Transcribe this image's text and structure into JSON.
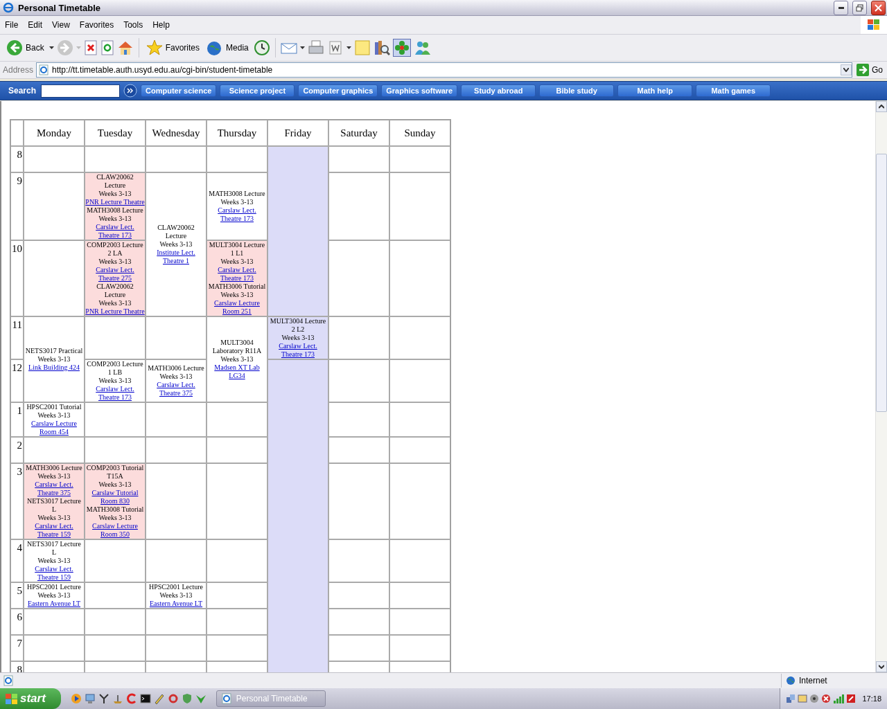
{
  "window": {
    "title": "Personal Timetable"
  },
  "menu": [
    "File",
    "Edit",
    "View",
    "Favorites",
    "Tools",
    "Help"
  ],
  "toolbar": {
    "back": "Back",
    "favorites": "Favorites",
    "media": "Media"
  },
  "address": {
    "label": "Address",
    "value": "http://tt.timetable.auth.usyd.edu.au/cgi-bin/student-timetable",
    "go": "Go"
  },
  "links_bar": {
    "search_label": "Search",
    "links": [
      "Computer science",
      "Science project",
      "Computer graphics",
      "Graphics software",
      "Study abroad",
      "Bible study",
      "Math help",
      "Math games"
    ]
  },
  "timetable": {
    "days": [
      "Monday",
      "Tuesday",
      "Wednesday",
      "Thursday",
      "Friday",
      "Saturday",
      "Sunday"
    ],
    "rows": [
      {
        "hour": "8",
        "cells": [
          {
            "color": "#ffffff"
          },
          {
            "color": "#ffffff"
          },
          {
            "color": "#ffffff"
          },
          {
            "color": "#ffffff"
          },
          {
            "color": "#dcdcf8",
            "rowspan": 3
          },
          {
            "color": "#ffffff"
          },
          {
            "color": "#ffffff"
          }
        ]
      },
      {
        "hour": "9",
        "cells": [
          {
            "color": "#ffffff"
          },
          {
            "color": "#fcdcdc",
            "sessions": [
              {
                "title": "CLAW20062 Lecture",
                "weeks": "Weeks 3-13",
                "room": "PNR Lecture Theatre"
              },
              {
                "title": "MATH3008 Lecture",
                "weeks": "Weeks 3-13",
                "room": "Carslaw Lect. Theatre 173"
              }
            ]
          },
          {
            "color": "#ffffff",
            "rowspan": 2,
            "sessions": [
              {
                "title": "CLAW20062 Lecture",
                "weeks": "Weeks 3-13",
                "room": "Institute Lect. Theatre 1"
              }
            ]
          },
          {
            "color": "#ffffff",
            "sessions": [
              {
                "title": "MATH3008 Lecture",
                "weeks": "Weeks 3-13",
                "room": "Carslaw Lect. Theatre 173"
              }
            ]
          },
          {
            "color": "#ffffff"
          },
          {
            "color": "#ffffff"
          }
        ]
      },
      {
        "hour": "10",
        "cells": [
          {
            "color": "#ffffff"
          },
          {
            "color": "#fcdcdc",
            "sessions": [
              {
                "title": "COMP2003 Lecture 2 LA",
                "weeks": "Weeks 3-13",
                "room": "Carslaw Lect. Theatre 275"
              },
              {
                "title": "CLAW20062 Lecture",
                "weeks": "Weeks 3-13",
                "room": "PNR Lecture Theatre"
              }
            ]
          },
          {
            "color": "#fcdcdc",
            "sessions": [
              {
                "title": "MULT3004 Lecture 1 L1",
                "weeks": "Weeks 3-13",
                "room": "Carslaw Lect. Theatre 173"
              },
              {
                "title": "MATH3006 Tutorial",
                "weeks": "Weeks 3-13",
                "room": "Carslaw Lecture Room 251"
              }
            ]
          },
          {
            "color": "#ffffff"
          },
          {
            "color": "#ffffff"
          }
        ]
      },
      {
        "hour": "11",
        "cells": [
          {
            "color": "#ffffff",
            "rowspan": 2,
            "sessions": [
              {
                "title": "NETS3017 Practical",
                "weeks": "Weeks 3-13",
                "room": "Link Building 424"
              }
            ]
          },
          {
            "color": "#ffffff"
          },
          {
            "color": "#ffffff"
          },
          {
            "color": "#ffffff",
            "rowspan": 2,
            "sessions": [
              {
                "title": "MULT3004 Laboratory R11A",
                "weeks": "Weeks 3-13",
                "room": "Madsen XT Lab LG34"
              }
            ]
          },
          {
            "color": "#dcdcf8",
            "sessions": [
              {
                "title": "MULT3004 Lecture 2 L2",
                "weeks": "Weeks 3-13",
                "room": "Carslaw Lect. Theatre 173"
              }
            ]
          },
          {
            "color": "#ffffff"
          },
          {
            "color": "#ffffff"
          }
        ]
      },
      {
        "hour": "12",
        "cells": [
          {
            "color": "#ffffff",
            "sessions": [
              {
                "title": "COMP2003 Lecture 1 LB",
                "weeks": "Weeks 3-13",
                "room": "Carslaw Lect. Theatre 173"
              }
            ]
          },
          {
            "color": "#ffffff",
            "sessions": [
              {
                "title": "MATH3006 Lecture",
                "weeks": "Weeks 3-13",
                "room": "Carslaw Lect. Theatre 375"
              }
            ]
          },
          {
            "color": "#dcdcf8",
            "rowspan": 9
          },
          {
            "color": "#ffffff"
          },
          {
            "color": "#ffffff"
          }
        ]
      },
      {
        "hour": "1",
        "cells": [
          {
            "color": "#ffffff",
            "sessions": [
              {
                "title": "HPSC2001 Tutorial",
                "weeks": "Weeks 3-13",
                "room": "Carslaw Lecture Room 454"
              }
            ]
          },
          {
            "color": "#ffffff"
          },
          {
            "color": "#ffffff"
          },
          {
            "color": "#ffffff"
          },
          {
            "color": "#ffffff"
          },
          {
            "color": "#ffffff"
          }
        ]
      },
      {
        "hour": "2",
        "cells": [
          {
            "color": "#ffffff"
          },
          {
            "color": "#ffffff"
          },
          {
            "color": "#ffffff"
          },
          {
            "color": "#ffffff"
          },
          {
            "color": "#ffffff"
          },
          {
            "color": "#ffffff"
          }
        ]
      },
      {
        "hour": "3",
        "cells": [
          {
            "color": "#fcdcdc",
            "sessions": [
              {
                "title": "MATH3006 Lecture",
                "weeks": "Weeks 3-13",
                "room": "Carslaw Lect. Theatre 375"
              },
              {
                "title": "NETS3017 Lecture L",
                "weeks": "Weeks 3-13",
                "room": "Carslaw Lect. Theatre 159"
              }
            ]
          },
          {
            "color": "#fcdcdc",
            "sessions": [
              {
                "title": "COMP2003 Tutorial T15A",
                "weeks": "Weeks 3-13",
                "room": "Carslaw Tutorial Room 830"
              },
              {
                "title": "MATH3008 Tutorial",
                "weeks": "Weeks 3-13",
                "room": "Carslaw Lecture Room 350"
              }
            ]
          },
          {
            "color": "#ffffff"
          },
          {
            "color": "#ffffff"
          },
          {
            "color": "#ffffff"
          },
          {
            "color": "#ffffff"
          }
        ]
      },
      {
        "hour": "4",
        "cells": [
          {
            "color": "#ffffff",
            "sessions": [
              {
                "title": "NETS3017 Lecture L",
                "weeks": "Weeks 3-13",
                "room": "Carslaw Lect. Theatre 159"
              }
            ]
          },
          {
            "color": "#ffffff"
          },
          {
            "color": "#ffffff"
          },
          {
            "color": "#ffffff"
          },
          {
            "color": "#ffffff"
          },
          {
            "color": "#ffffff"
          }
        ]
      },
      {
        "hour": "5",
        "cells": [
          {
            "color": "#ffffff",
            "sessions": [
              {
                "title": "HPSC2001 Lecture",
                "weeks": "Weeks 3-13",
                "room": "Eastern Avenue LT"
              }
            ]
          },
          {
            "color": "#ffffff"
          },
          {
            "color": "#ffffff",
            "sessions": [
              {
                "title": "HPSC2001 Lecture",
                "weeks": "Weeks 3-13",
                "room": "Eastern Avenue LT"
              }
            ]
          },
          {
            "color": "#ffffff"
          },
          {
            "color": "#ffffff"
          },
          {
            "color": "#ffffff"
          }
        ]
      },
      {
        "hour": "6",
        "cells": [
          {
            "color": "#ffffff"
          },
          {
            "color": "#ffffff"
          },
          {
            "color": "#ffffff"
          },
          {
            "color": "#ffffff"
          },
          {
            "color": "#ffffff"
          },
          {
            "color": "#ffffff"
          }
        ]
      },
      {
        "hour": "7",
        "cells": [
          {
            "color": "#ffffff"
          },
          {
            "color": "#ffffff"
          },
          {
            "color": "#ffffff"
          },
          {
            "color": "#ffffff"
          },
          {
            "color": "#ffffff"
          },
          {
            "color": "#ffffff"
          }
        ]
      },
      {
        "hour": "8",
        "cells": [
          {
            "color": "#ffffff"
          },
          {
            "color": "#ffffff"
          },
          {
            "color": "#ffffff"
          },
          {
            "color": "#ffffff"
          },
          {
            "color": "#ffffff"
          },
          {
            "color": "#ffffff"
          }
        ]
      }
    ]
  },
  "status_bar": {
    "zone": "Internet"
  },
  "taskbar": {
    "start": "start",
    "tasks": [
      "Personal Timetable"
    ],
    "clock": "17:18"
  }
}
